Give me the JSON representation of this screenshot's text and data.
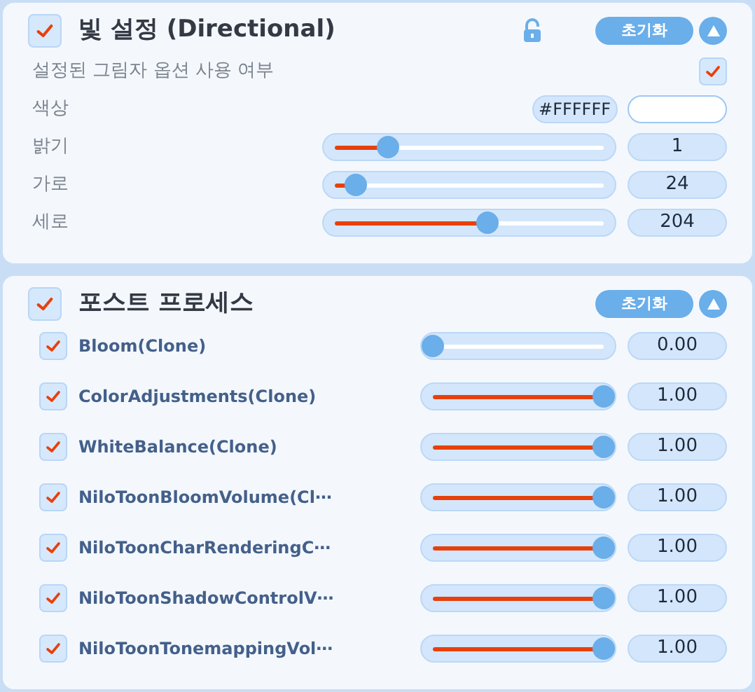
{
  "light_panel": {
    "checked": true,
    "title": "빛 설정 (Directional)",
    "locked": false,
    "reset_label": "초기화",
    "expanded": true,
    "rows": [
      {
        "kind": "checkbox",
        "label": "설정된 그림자 옵션 사용 여부",
        "checked": true
      },
      {
        "kind": "color",
        "label": "색상",
        "hex": "#FFFFFF",
        "color": "#ffffff"
      },
      {
        "kind": "slider",
        "label": "밝기",
        "level": 0.2,
        "reading": "1"
      },
      {
        "kind": "slider",
        "label": "가로",
        "level": 0.08,
        "reading": "24"
      },
      {
        "kind": "slider",
        "label": "세로",
        "level": 0.57,
        "reading": "204"
      }
    ]
  },
  "post_panel": {
    "checked": true,
    "title": "포스트 프로세스",
    "reset_label": "초기화",
    "expanded": true,
    "items": [
      {
        "label": "Bloom(Clone)",
        "checked": true,
        "level": 0,
        "reading": "0.00"
      },
      {
        "label": "ColorAdjustments(Clone)",
        "checked": true,
        "level": 1,
        "reading": "1.00"
      },
      {
        "label": "WhiteBalance(Clone)",
        "checked": true,
        "level": 1,
        "reading": "1.00"
      },
      {
        "label": "NiloToonBloomVolume(Cl⋯",
        "checked": true,
        "level": 1,
        "reading": "1.00"
      },
      {
        "label": "NiloToonCharRenderingC⋯",
        "checked": true,
        "level": 1,
        "reading": "1.00"
      },
      {
        "label": "NiloToonShadowControlV⋯",
        "checked": true,
        "level": 1,
        "reading": "1.00"
      },
      {
        "label": "NiloToonTonemappingVol⋯",
        "checked": true,
        "level": 1,
        "reading": "1.00"
      }
    ]
  }
}
